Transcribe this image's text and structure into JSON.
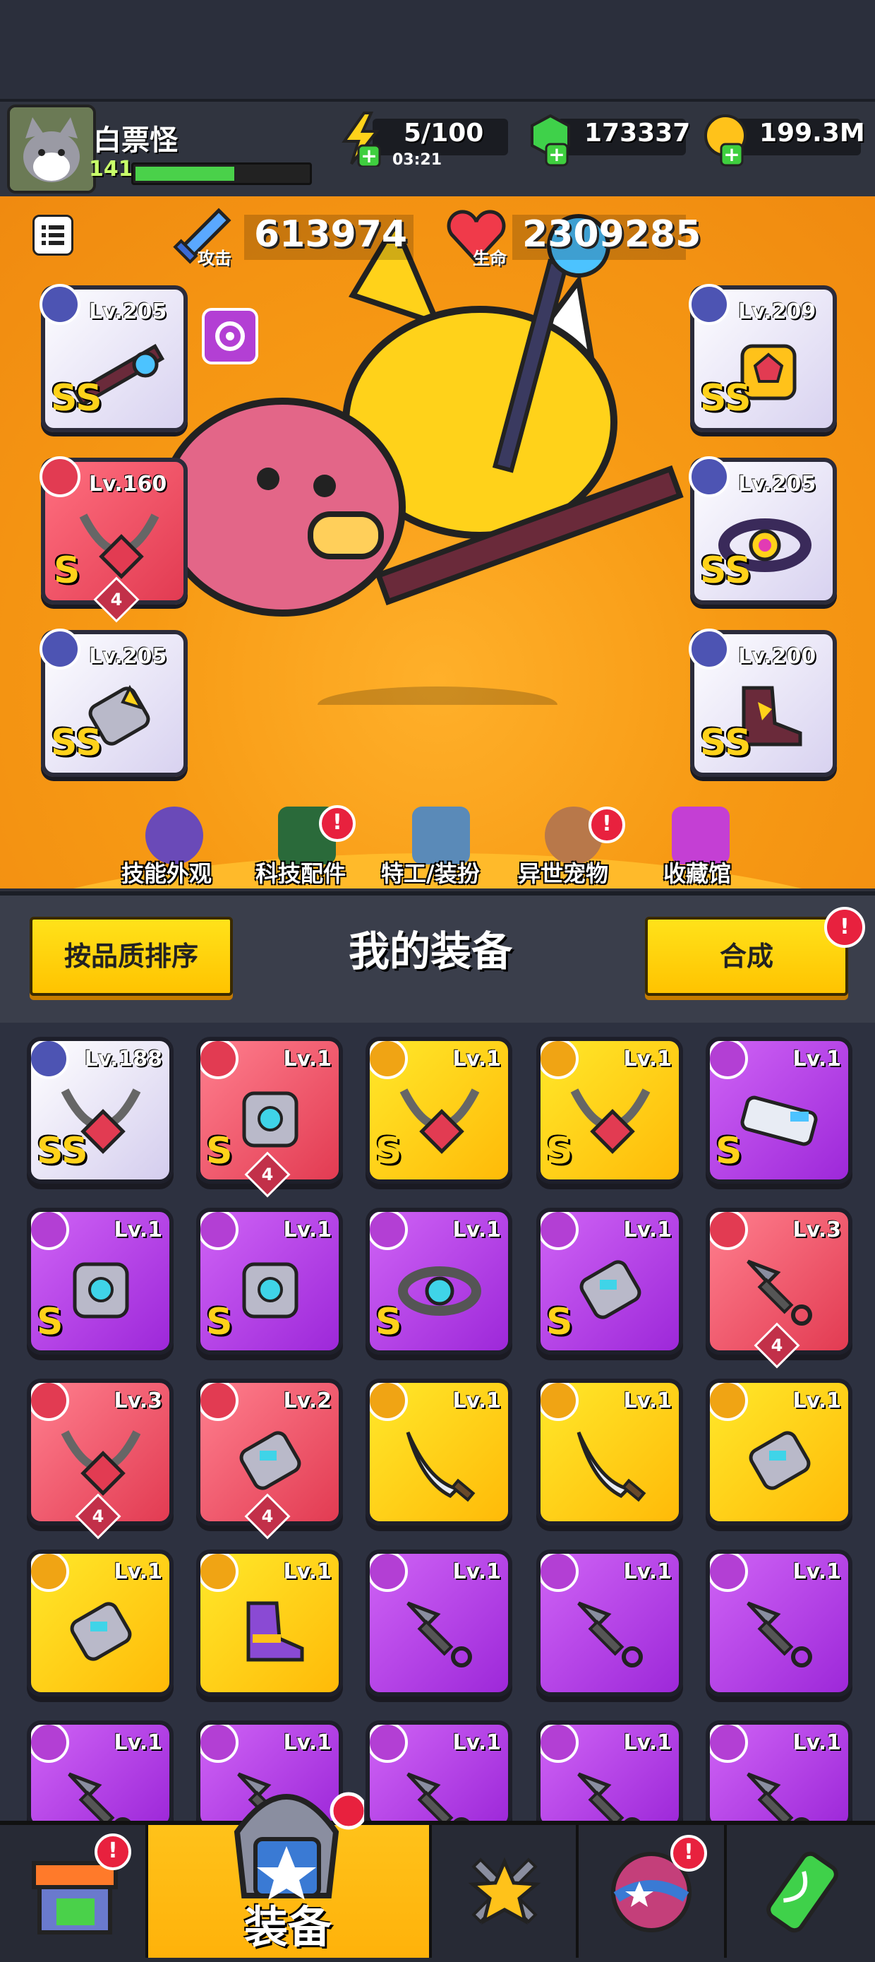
{
  "player": {
    "name": "白票怪",
    "level": "141",
    "xp_fraction": 0.56
  },
  "resources": {
    "energy": "5/100",
    "energy_timer": "03:21",
    "gems": "173337",
    "coins": "199.3M"
  },
  "stats": {
    "attack_value": "613974",
    "attack_label": "攻击",
    "hp_value": "2309285",
    "hp_label": "生命"
  },
  "equipped": {
    "weapon": {
      "level": "Lv.205",
      "rank": "SS"
    },
    "necklace": {
      "level": "Lv.160",
      "rank": "S",
      "stars": "4"
    },
    "gloves": {
      "level": "Lv.205",
      "rank": "SS"
    },
    "armor": {
      "level": "Lv.209",
      "rank": "SS"
    },
    "belt": {
      "level": "Lv.205",
      "rank": "SS"
    },
    "boots": {
      "level": "Lv.200",
      "rank": "SS"
    }
  },
  "feature_tabs": [
    {
      "label": "技能外观"
    },
    {
      "label": "科技配件",
      "badge": "!"
    },
    {
      "label": "特工/装扮"
    },
    {
      "label": "异世宠物",
      "badge": "!"
    },
    {
      "label": "收藏馆"
    }
  ],
  "sort_button": "按品质排序",
  "section_title": "我的装备",
  "merge_button": "合成",
  "merge_badge": "!",
  "inventory": [
    {
      "level": "Lv.188",
      "rank": "SS",
      "color": "white",
      "item": "necklace"
    },
    {
      "level": "Lv.1",
      "rank": "S",
      "color": "red",
      "item": "armor",
      "stars": "4"
    },
    {
      "level": "Lv.1",
      "rank": "S",
      "color": "yellow",
      "item": "necklace"
    },
    {
      "level": "Lv.1",
      "rank": "S",
      "color": "yellow",
      "item": "necklace"
    },
    {
      "level": "Lv.1",
      "rank": "S",
      "color": "purple",
      "item": "weapon"
    },
    {
      "level": "Lv.1",
      "rank": "S",
      "color": "purple",
      "item": "armor"
    },
    {
      "level": "Lv.1",
      "rank": "S",
      "color": "purple",
      "item": "armor"
    },
    {
      "level": "Lv.1",
      "rank": "S",
      "color": "purple",
      "item": "belt"
    },
    {
      "level": "Lv.1",
      "rank": "S",
      "color": "purple",
      "item": "gloves"
    },
    {
      "level": "Lv.3",
      "rank": "",
      "color": "red",
      "item": "kunai",
      "stars": "4"
    },
    {
      "level": "Lv.3",
      "rank": "",
      "color": "red",
      "item": "necklace",
      "stars": "4"
    },
    {
      "level": "Lv.2",
      "rank": "",
      "color": "red",
      "item": "gloves",
      "stars": "4"
    },
    {
      "level": "Lv.1",
      "rank": "",
      "color": "yellow",
      "item": "sword"
    },
    {
      "level": "Lv.1",
      "rank": "",
      "color": "yellow",
      "item": "sword"
    },
    {
      "level": "Lv.1",
      "rank": "",
      "color": "yellow",
      "item": "gloves"
    },
    {
      "level": "Lv.1",
      "rank": "",
      "color": "yellow",
      "item": "gloves"
    },
    {
      "level": "Lv.1",
      "rank": "",
      "color": "yellow",
      "item": "boots"
    },
    {
      "level": "Lv.1",
      "rank": "",
      "color": "purple",
      "item": "kunai"
    },
    {
      "level": "Lv.1",
      "rank": "",
      "color": "purple",
      "item": "kunai"
    },
    {
      "level": "Lv.1",
      "rank": "",
      "color": "purple",
      "item": "kunai"
    },
    {
      "level": "Lv.1",
      "rank": "",
      "color": "purple",
      "item": "kunai"
    },
    {
      "level": "Lv.1",
      "rank": "",
      "color": "purple",
      "item": "kunai"
    },
    {
      "level": "Lv.1",
      "rank": "",
      "color": "purple",
      "item": "kunai"
    },
    {
      "level": "Lv.1",
      "rank": "",
      "color": "purple",
      "item": "kunai"
    },
    {
      "level": "Lv.1",
      "rank": "",
      "color": "purple",
      "item": "kunai"
    }
  ],
  "bottom_nav": [
    {
      "label": "",
      "icon": "shop-icon",
      "badge": "!"
    },
    {
      "label": "装备",
      "icon": "equipment-icon",
      "selected": true
    },
    {
      "label": "",
      "icon": "battle-icon"
    },
    {
      "label": "",
      "icon": "planet-icon",
      "badge": "!"
    },
    {
      "label": "",
      "icon": "dna-icon"
    }
  ]
}
